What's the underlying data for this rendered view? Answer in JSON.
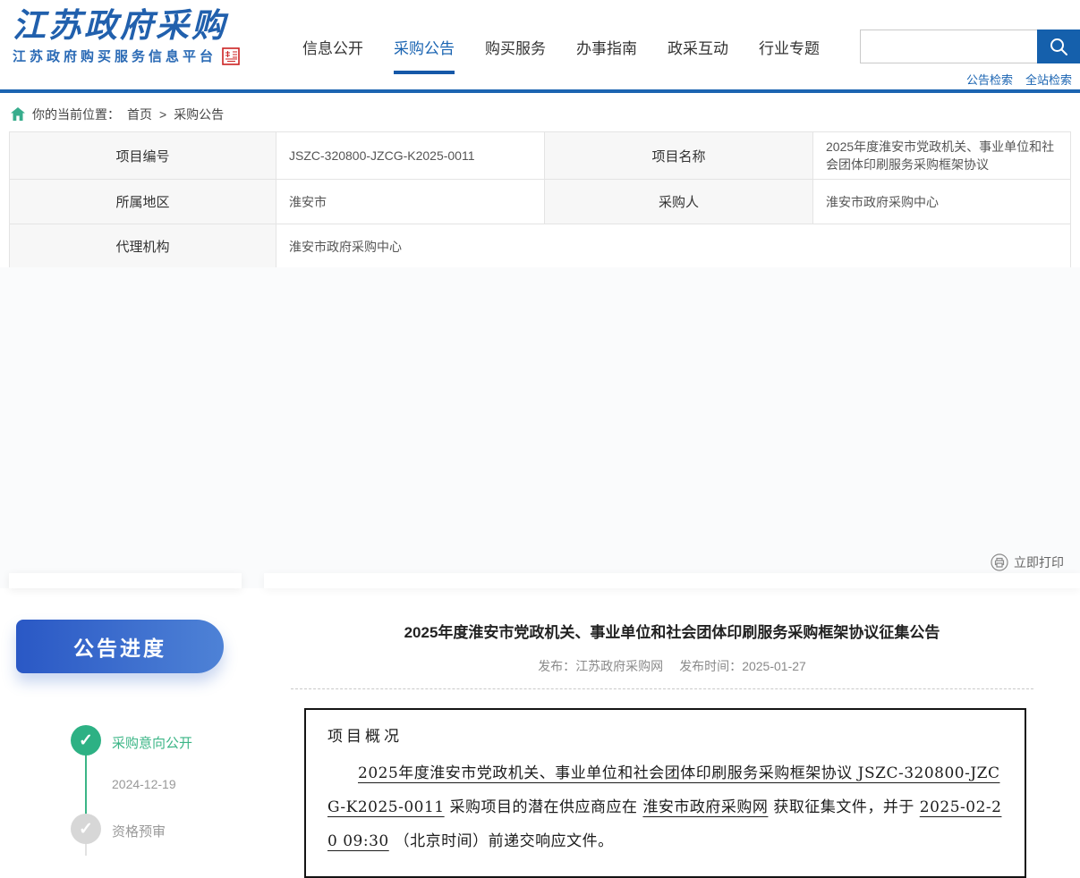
{
  "colors": {
    "accent_blue": "#1b64b1",
    "nav_active_blue": "#1a64b2",
    "pill_gradient_start": "#2a58c5",
    "pill_gradient_end": "#4e82d6",
    "done_green": "#2db184",
    "pending_gray": "#d7d7d7",
    "seal_red": "#cc2222"
  },
  "header": {
    "logo_title": "江苏政府采购",
    "logo_subtitle": "江苏政府购买服务信息平台",
    "nav": [
      {
        "label": "信息公开"
      },
      {
        "label": "采购公告"
      },
      {
        "label": "购买服务"
      },
      {
        "label": "办事指南"
      },
      {
        "label": "政采互动"
      },
      {
        "label": "行业专题"
      }
    ],
    "search": {
      "placeholder": "",
      "value": ""
    },
    "search_links": [
      {
        "label": "公告检索"
      },
      {
        "label": "全站检索"
      }
    ]
  },
  "breadcrumb": {
    "prefix": "你的当前位置：",
    "items": [
      {
        "label": "首页"
      },
      {
        "label": "采购公告"
      }
    ],
    "separator": ">"
  },
  "info_table": {
    "rows": [
      {
        "l1": "项目编号",
        "v1": "JSZC-320800-JZCG-K2025-0011",
        "l2": "项目名称",
        "v2": "2025年度淮安市党政机关、事业单位和社会团体印刷服务采购框架协议"
      },
      {
        "l1": "所属地区",
        "v1": "淮安市",
        "l2": "采购人",
        "v2": "淮安市政府采购中心"
      },
      {
        "l1": "代理机构",
        "v1": "淮安市政府采购中心"
      }
    ]
  },
  "print": {
    "label": "立即打印"
  },
  "sidebar": {
    "title": "公告进度",
    "steps": [
      {
        "label": "采购意向公开",
        "date": "2024-12-19",
        "status": "done"
      },
      {
        "label": "资格预审",
        "status": "pending"
      }
    ]
  },
  "article": {
    "title": "2025年度淮安市党政机关、事业单位和社会团体印刷服务采购框架协议征集公告",
    "publisher_label": "发布：",
    "publisher": "江苏政府采购网",
    "time_label": "发布时间：",
    "publish_time": "2025-01-27",
    "overview": {
      "heading": "项目概况",
      "segments": [
        {
          "text": "2025年度淮安市党政机关、事业单位和社会团体印刷服务采购框架协议 JSZC-320800-JZCG-K2025-0011",
          "underline": true
        },
        {
          "text": " 采购项目的潜在供应商应在 ",
          "underline": false
        },
        {
          "text": "淮安市政府采购网",
          "underline": true
        },
        {
          "text": " 获取征集文件，并于 ",
          "underline": false
        },
        {
          "text": "2025-02-20 09:30",
          "underline": true
        },
        {
          "text": " （北京时间）前递交响应文件。",
          "underline": false
        }
      ]
    }
  }
}
